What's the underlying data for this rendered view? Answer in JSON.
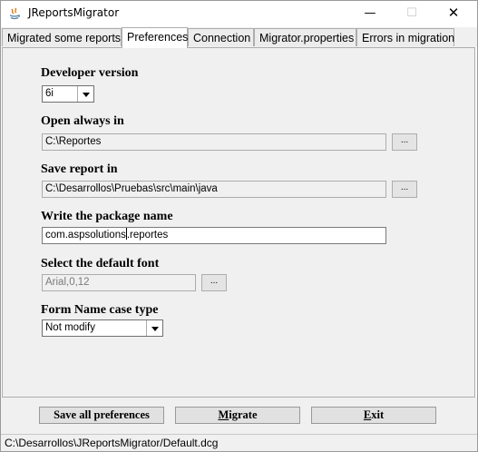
{
  "window": {
    "title": "JReportsMigrator",
    "minimize_glyph": "—",
    "maximize_glyph": "☐",
    "close_glyph": "✕"
  },
  "tabs": [
    {
      "label": "Migrated some reports",
      "active": false
    },
    {
      "label": "Preferences",
      "active": true
    },
    {
      "label": "Connection",
      "active": false
    },
    {
      "label": "Migrator.properties",
      "active": false
    },
    {
      "label": "Errors in migration",
      "active": false
    }
  ],
  "preferences": {
    "developer_version": {
      "label": "Developer version",
      "value": "6i"
    },
    "open_always_in": {
      "label": "Open always in",
      "value": "C:\\Reportes",
      "browse": "..."
    },
    "save_report_in": {
      "label": "Save report in",
      "value": "C:\\Desarrollos\\Pruebas\\src\\main\\java",
      "browse": "..."
    },
    "package_name": {
      "label": "Write the package name",
      "value_before_caret": "com.aspsolutions",
      "value_after_caret": ".reportes"
    },
    "default_font": {
      "label": "Select the default font",
      "value": "Arial,0,12",
      "browse": "..."
    },
    "form_name_case": {
      "label": "Form Name case type",
      "value": "Not modify"
    }
  },
  "buttons": {
    "save_all": "Save all preferences",
    "migrate_first": "M",
    "migrate_rest": "igrate",
    "exit_first": "E",
    "exit_rest": "xit"
  },
  "status_bar": "C:\\Desarrollos\\JReportsMigrator/Default.dcg"
}
